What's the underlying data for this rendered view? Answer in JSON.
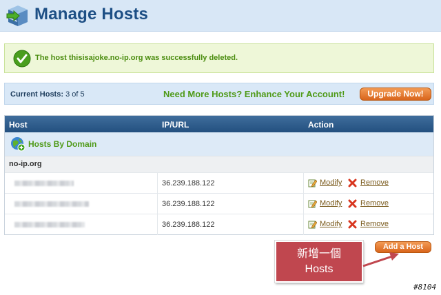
{
  "header": {
    "title": "Manage Hosts",
    "logo_icon": "server-stack-icon"
  },
  "alert": {
    "message": "The host thisisajoke.no-ip.org was successfully deleted.",
    "icon": "checkmark-icon",
    "color": "#4a8c0e"
  },
  "account": {
    "current_label": "Current Hosts:",
    "current_value": "3 of 5",
    "pitch": "Need More Hosts? Enhance Your Account!",
    "upgrade_label": "Upgrade Now!"
  },
  "table": {
    "columns": [
      "Host",
      "IP/URL",
      "Action"
    ],
    "group_title": "Hosts By Domain",
    "group_icon": "globe-add-icon",
    "domain": "no-ip.org",
    "rows": [
      {
        "host": "",
        "ip": "36.239.188.122",
        "modify": "Modify",
        "remove": "Remove"
      },
      {
        "host": "",
        "ip": "36.239.188.122",
        "modify": "Modify",
        "remove": "Remove"
      },
      {
        "host": "",
        "ip": "36.239.188.122",
        "modify": "Modify",
        "remove": "Remove"
      }
    ]
  },
  "add_host_label": "Add a Host",
  "annotation": {
    "line1": "新增一個",
    "line2": "Hosts",
    "color": "#c0474f"
  },
  "watermark": "#8104",
  "colors": {
    "brand": "#1d4f85",
    "accent_orange": "#e0722a",
    "green": "#4f9a18",
    "header_bg": "#d8e7f6"
  }
}
